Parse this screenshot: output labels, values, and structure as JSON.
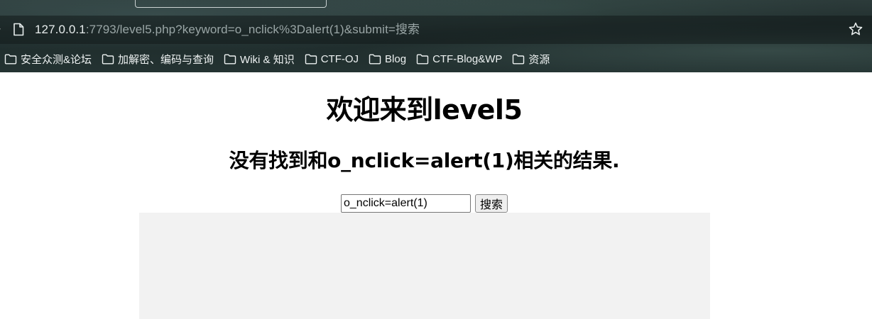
{
  "browser": {
    "url_host": "127.0.0.1",
    "url_rest": ":7793/level5.php?keyword=o_nclick%3Dalert(1)&submit=搜索",
    "bookmarks": [
      {
        "label": "安全众测&论坛",
        "icon": "folder-icon"
      },
      {
        "label": "加解密、编码与查询",
        "icon": "folder-icon"
      },
      {
        "label": "Wiki & 知识",
        "icon": "folder-icon"
      },
      {
        "label": "CTF-OJ",
        "icon": "folder-icon"
      },
      {
        "label": "Blog",
        "icon": "folder-icon"
      },
      {
        "label": "CTF-Blog&WP",
        "icon": "folder-icon"
      },
      {
        "label": "资源",
        "icon": "folder-icon"
      }
    ]
  },
  "page": {
    "title": "欢迎来到level5",
    "result": "没有找到和o_nclick=alert(1)相关的结果.",
    "search": {
      "value": "o_nclick=alert(1)",
      "button_label": "搜索"
    }
  }
}
